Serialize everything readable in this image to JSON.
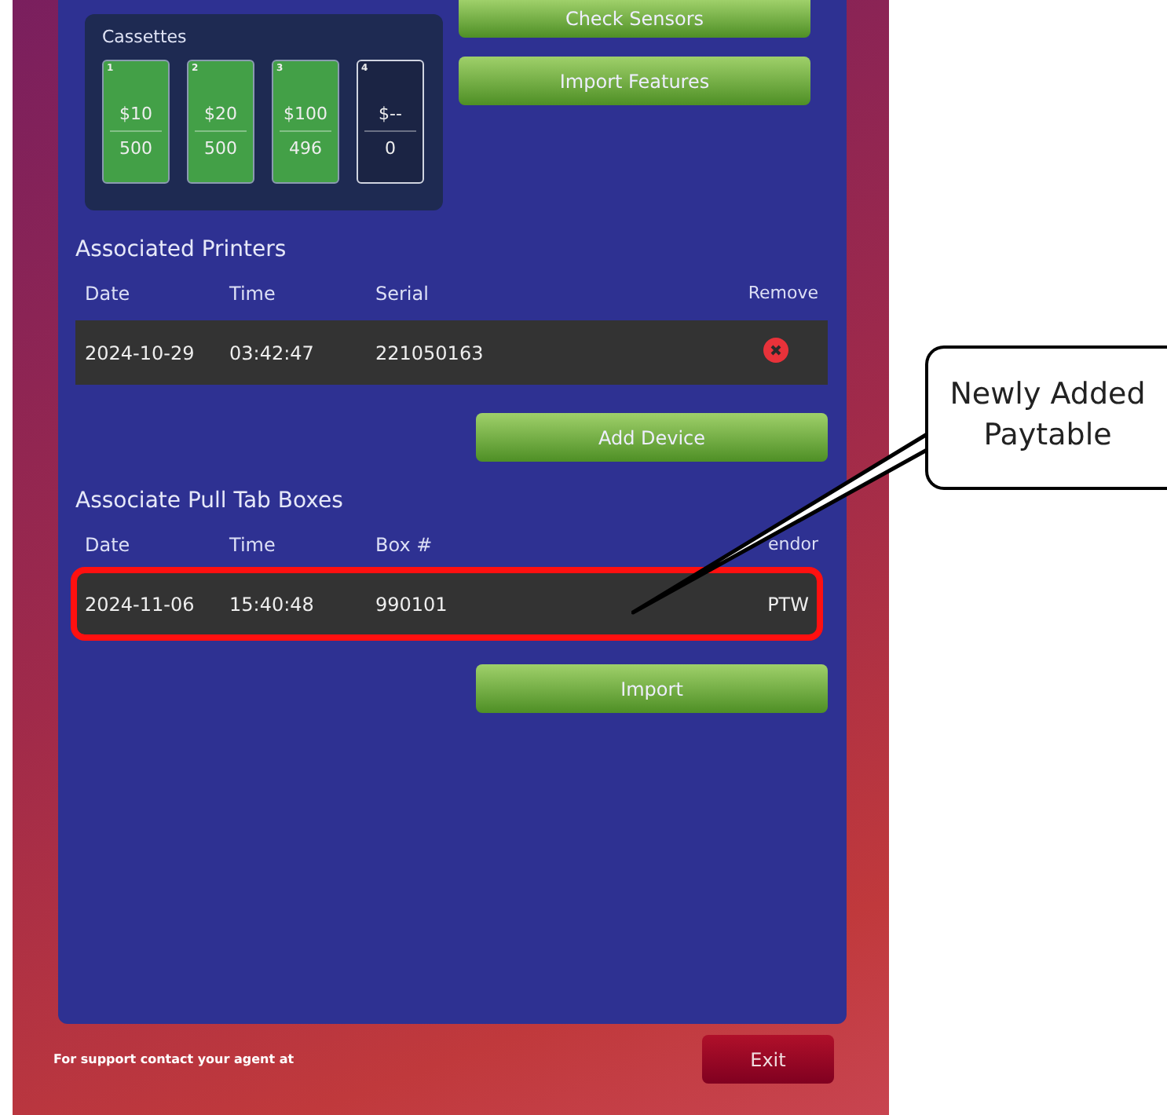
{
  "side_buttons": [
    "Check Sensors",
    "Import Features"
  ],
  "cassettes": {
    "title": "Cassettes",
    "items": [
      {
        "number": "1",
        "value": "$10",
        "count": "500",
        "loaded": true
      },
      {
        "number": "2",
        "value": "$20",
        "count": "500",
        "loaded": true
      },
      {
        "number": "3",
        "value": "$100",
        "count": "496",
        "loaded": true
      },
      {
        "number": "4",
        "value": "$--",
        "count": "0",
        "loaded": false
      }
    ]
  },
  "printers": {
    "title": "Associated Printers",
    "columns": [
      "Date",
      "Time",
      "Serial",
      "Remove"
    ],
    "rows": [
      {
        "cells": [
          "2024-10-29",
          "03:42:47",
          "221050163"
        ],
        "removable": true
      }
    ],
    "button": "Add Device"
  },
  "pull_tabs": {
    "title": "Associate Pull Tab Boxes",
    "columns": [
      "Date",
      "Time",
      "Box #",
      "endor"
    ],
    "rows": [
      {
        "cells": [
          "2024-11-06",
          "15:40:48",
          "990101",
          "PTW"
        ],
        "highlighted": true
      }
    ],
    "button": "Import"
  },
  "footer": {
    "text": "For support contact your agent at",
    "button": "Exit"
  },
  "callout": {
    "text": "Newly Added Paytable"
  }
}
